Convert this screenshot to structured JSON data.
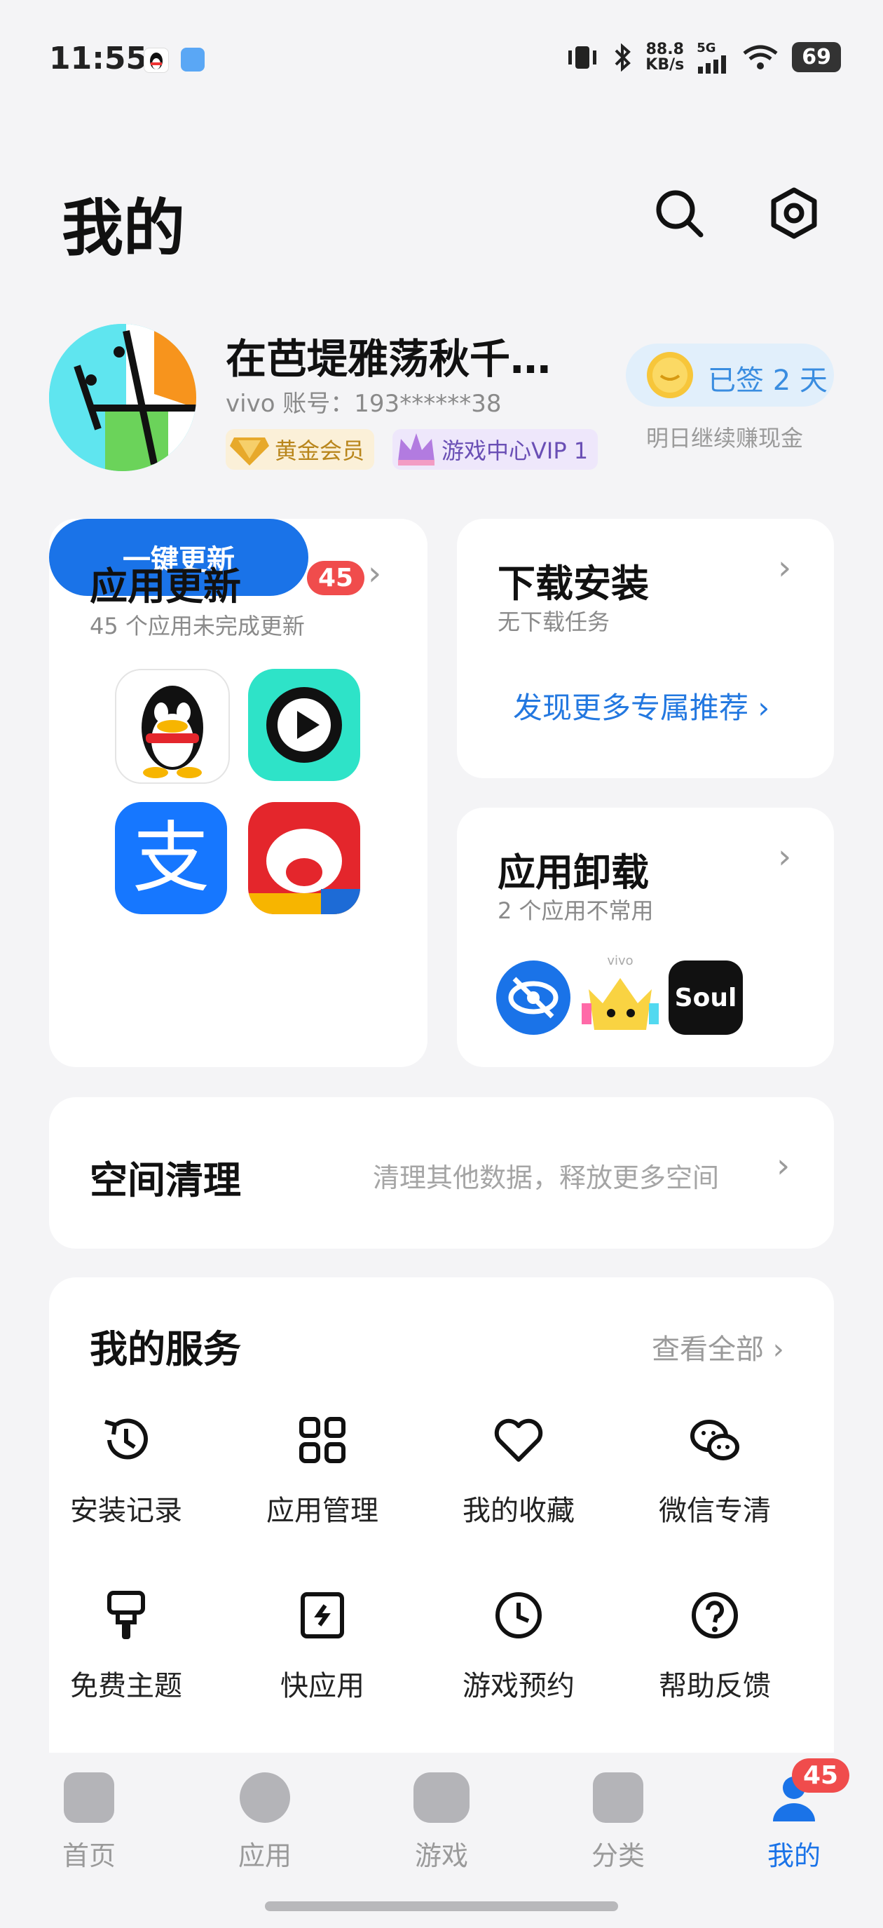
{
  "status": {
    "time": "11:55",
    "net_speed_top": "88.8",
    "net_speed_unit": "KB/s",
    "net_type": "5G",
    "battery": "69"
  },
  "header": {
    "title": "我的"
  },
  "profile": {
    "name": "在芭堤雅荡秋千…",
    "account": "vivo 账号：193******38",
    "gold_badge": "黄金会员",
    "vip_badge": "游戏中心VIP 1",
    "sign_label": "已签 2 天",
    "sign_sub": "明日继续赚现金"
  },
  "app_update": {
    "title": "应用更新",
    "count": "45",
    "subtitle": "45 个应用未完成更新",
    "button": "一键更新"
  },
  "download": {
    "title": "下载安装",
    "subtitle": "无下载任务",
    "link": "发现更多专属推荐"
  },
  "uninstall": {
    "title": "应用卸载",
    "subtitle": "2 个应用不常用",
    "soul_text": "Soul",
    "vivo_text": "vivo"
  },
  "cleanup": {
    "title": "空间清理",
    "subtitle": "清理其他数据，释放更多空间"
  },
  "services": {
    "title": "我的服务",
    "view_all": "查看全部",
    "items": [
      {
        "label": "安装记录",
        "icon": "history-icon"
      },
      {
        "label": "应用管理",
        "icon": "grid-icon"
      },
      {
        "label": "我的收藏",
        "icon": "heart-icon"
      },
      {
        "label": "微信专清",
        "icon": "wechat-icon"
      },
      {
        "label": "免费主题",
        "icon": "brush-icon"
      },
      {
        "label": "快应用",
        "icon": "quick-app-icon"
      },
      {
        "label": "游戏预约",
        "icon": "clock-icon"
      },
      {
        "label": "帮助反馈",
        "icon": "help-icon"
      }
    ]
  },
  "tabs": [
    {
      "label": "首页"
    },
    {
      "label": "应用"
    },
    {
      "label": "游戏"
    },
    {
      "label": "分类"
    },
    {
      "label": "我的",
      "badge": "45"
    }
  ]
}
